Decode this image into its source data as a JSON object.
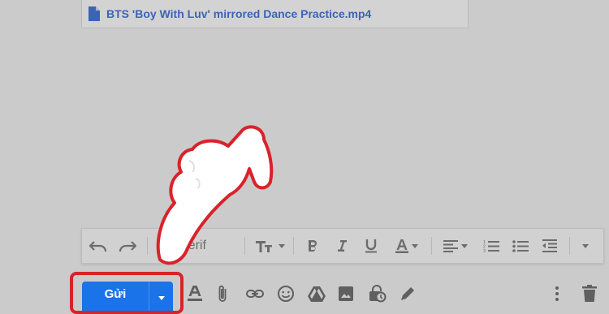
{
  "attachment": {
    "file_name": "BTS 'Boy With Luv' mirrored Dance Practice.mp4",
    "icon": "file-icon"
  },
  "format_toolbar": {
    "font_family_value": "Serif",
    "icons": [
      "undo-icon",
      "redo-icon",
      "font-size-icon",
      "bold-icon",
      "italic-icon",
      "underline-icon",
      "text-color-icon",
      "align-icon",
      "numbered-list-icon",
      "bulleted-list-icon",
      "indent-less-icon",
      "more-formatting-icon"
    ]
  },
  "compose": {
    "send_label": "Gửi",
    "icons": [
      "formatting-options-icon",
      "attach-file-icon",
      "insert-link-icon",
      "emoji-icon",
      "google-drive-icon",
      "insert-photo-icon",
      "confidential-mode-icon",
      "signature-icon",
      "more-options-icon",
      "discard-icon"
    ]
  },
  "colors": {
    "accent": "#1a73e8",
    "highlight": "#d8232a",
    "link": "#3e63b5"
  }
}
